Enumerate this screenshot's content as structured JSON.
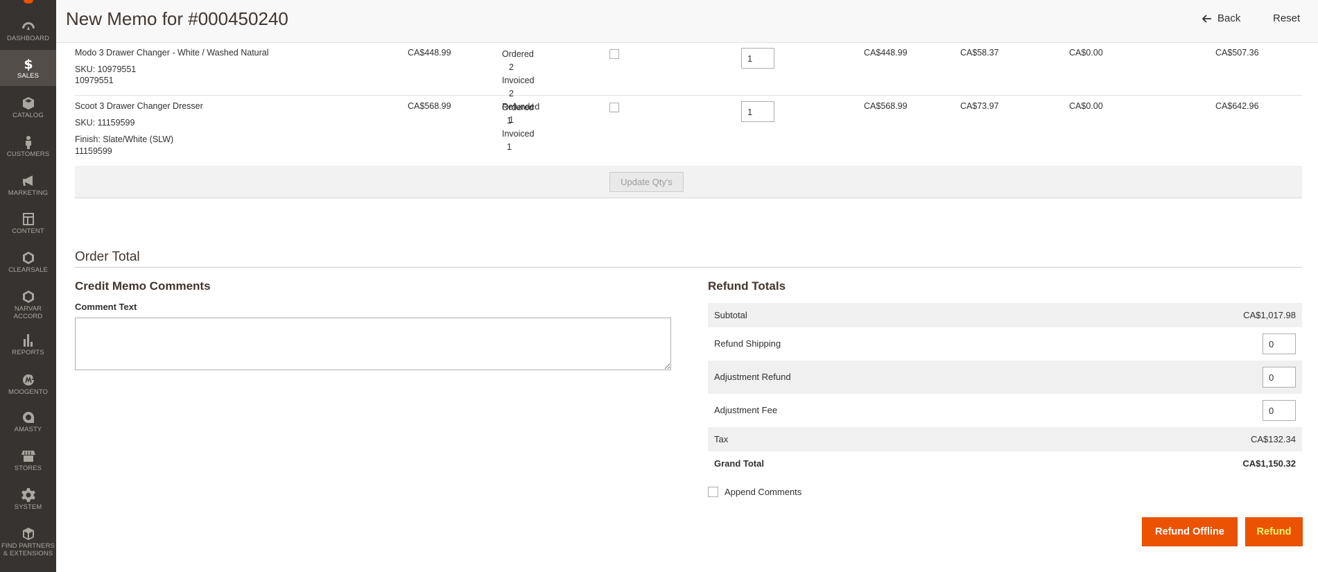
{
  "sidebar": {
    "items": [
      {
        "label": "DASHBOARD",
        "icon": "speedometer-icon"
      },
      {
        "label": "SALES",
        "icon": "dollar-icon"
      },
      {
        "label": "CATALOG",
        "icon": "box-icon"
      },
      {
        "label": "CUSTOMERS",
        "icon": "person-icon"
      },
      {
        "label": "MARKETING",
        "icon": "megaphone-icon"
      },
      {
        "label": "CONTENT",
        "icon": "layout-icon"
      },
      {
        "label": "CLEARSALE",
        "icon": "hexagon-icon"
      },
      {
        "label": "NARVAR",
        "label2": "ACCORD",
        "icon": "hexagon-icon"
      },
      {
        "label": "REPORTS",
        "icon": "bar-chart-icon"
      },
      {
        "label": "MOOGENTO",
        "icon": "moogento-icon"
      },
      {
        "label": "AMASTY",
        "icon": "amasty-icon"
      },
      {
        "label": "STORES",
        "icon": "storefront-icon"
      },
      {
        "label": "SYSTEM",
        "icon": "gear-icon"
      },
      {
        "label": "FIND PARTNERS",
        "label2": "& EXTENSIONS",
        "icon": "cube-icon"
      }
    ]
  },
  "header": {
    "title": "New Memo for #000450240",
    "back_label": "Back",
    "reset_label": "Reset"
  },
  "items": [
    {
      "name": "Modo 3 Drawer Changer - White / Washed Natural",
      "sku": "SKU: 10979551",
      "extra": "",
      "code": "10979551",
      "price": "CA$448.99",
      "qty_lines": [
        {
          "label": "Ordered",
          "value": "2"
        },
        {
          "label": "Invoiced",
          "value": "2"
        },
        {
          "label": "Refunded",
          "value": "1"
        }
      ],
      "qty_to_refund": "1",
      "subtotal": "CA$448.99",
      "tax": "CA$58.37",
      "discount": "CA$0.00",
      "row_total": "CA$507.36"
    },
    {
      "name": "Scoot 3 Drawer Changer Dresser",
      "sku": "SKU: 11159599",
      "extra": "Finish: Slate/White (SLW)",
      "code": "11159599",
      "price": "CA$568.99",
      "qty_lines": [
        {
          "label": "Ordered",
          "value": "1"
        },
        {
          "label": "Invoiced",
          "value": "1"
        }
      ],
      "qty_to_refund": "1",
      "subtotal": "CA$568.99",
      "tax": "CA$73.97",
      "discount": "CA$0.00",
      "row_total": "CA$642.96"
    }
  ],
  "update_qty_label": "Update Qty's",
  "order_total": {
    "section_title": "Order Total",
    "comments_title": "Credit Memo Comments",
    "comment_label": "Comment Text",
    "comment_value": "",
    "refund_title": "Refund Totals",
    "subtotal_label": "Subtotal",
    "subtotal_value": "CA$1,017.98",
    "refund_shipping_label": "Refund Shipping",
    "refund_shipping_value": "0",
    "adjustment_refund_label": "Adjustment Refund",
    "adjustment_refund_value": "0",
    "adjustment_fee_label": "Adjustment Fee",
    "adjustment_fee_value": "0",
    "tax_label": "Tax",
    "tax_value": "CA$132.34",
    "grand_total_label": "Grand Total",
    "grand_total_value": "CA$1,150.32",
    "append_comments_label": "Append Comments",
    "refund_offline_label": "Refund Offline",
    "refund_label": "Refund"
  },
  "colors": {
    "sidebar_bg": "#373330",
    "accent": "#eb5202",
    "refund_text": "#fff56e"
  }
}
